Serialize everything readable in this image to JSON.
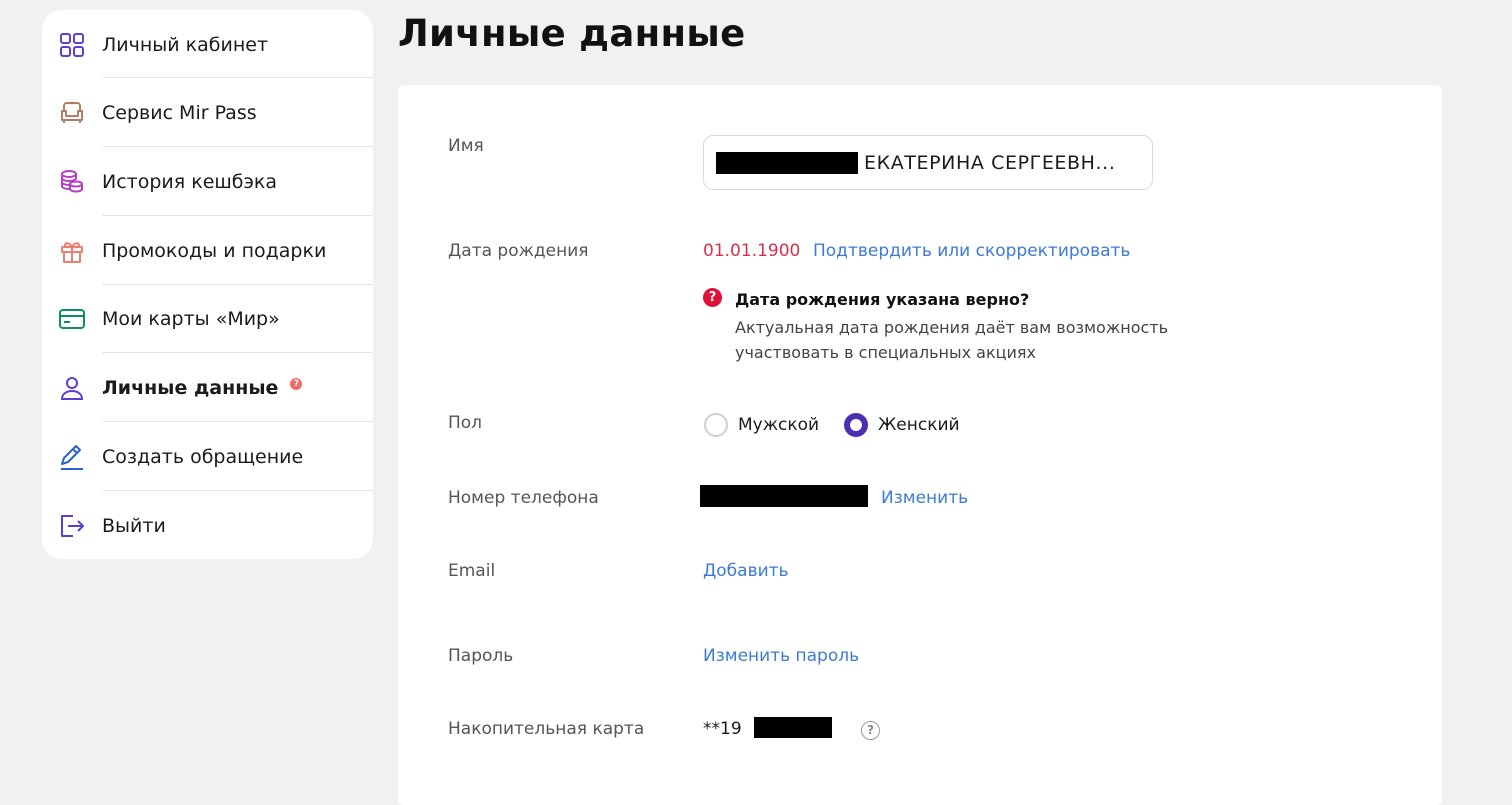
{
  "sidebar": {
    "items": [
      {
        "label": "Личный кабинет",
        "icon": "grid-icon"
      },
      {
        "label": "Сервис Mir Pass",
        "icon": "armchair-icon"
      },
      {
        "label": "История кешбэка",
        "icon": "coins-icon"
      },
      {
        "label": "Промокоды и подарки",
        "icon": "gift-icon"
      },
      {
        "label": "Мои карты «Мир»",
        "icon": "card-icon"
      },
      {
        "label": "Личные данные",
        "icon": "user-icon",
        "badge": "?"
      },
      {
        "label": "Создать обращение",
        "icon": "pen-icon"
      },
      {
        "label": "Выйти",
        "icon": "logout-icon"
      }
    ]
  },
  "page": {
    "title": "Личные данные"
  },
  "form": {
    "name": {
      "label": "Имя",
      "value": "ЕКАТЕРИНА СЕРГЕЕВН..."
    },
    "birth": {
      "label": "Дата рождения",
      "value": "01.01.1900",
      "link": "Подтвердить или скорректировать",
      "notice_icon": "?",
      "notice_title": "Дата рождения указана верно?",
      "notice_text": "Актуальная дата рождения даёт вам возможность участвовать в специальных акциях"
    },
    "gender": {
      "label": "Пол",
      "options": [
        "Мужской",
        "Женский"
      ],
      "selected": "Женский"
    },
    "phone": {
      "label": "Номер телефона",
      "link": "Изменить"
    },
    "email": {
      "label": "Email",
      "link": "Добавить"
    },
    "password": {
      "label": "Пароль",
      "link": "Изменить пароль"
    },
    "loyalty": {
      "label": "Накопительная карта",
      "value": "**19",
      "help_icon": "?"
    }
  },
  "colors": {
    "accent": "#4b2fb0",
    "link": "#3d7ad6",
    "danger": "#e0103a",
    "date": "#d9304a"
  }
}
